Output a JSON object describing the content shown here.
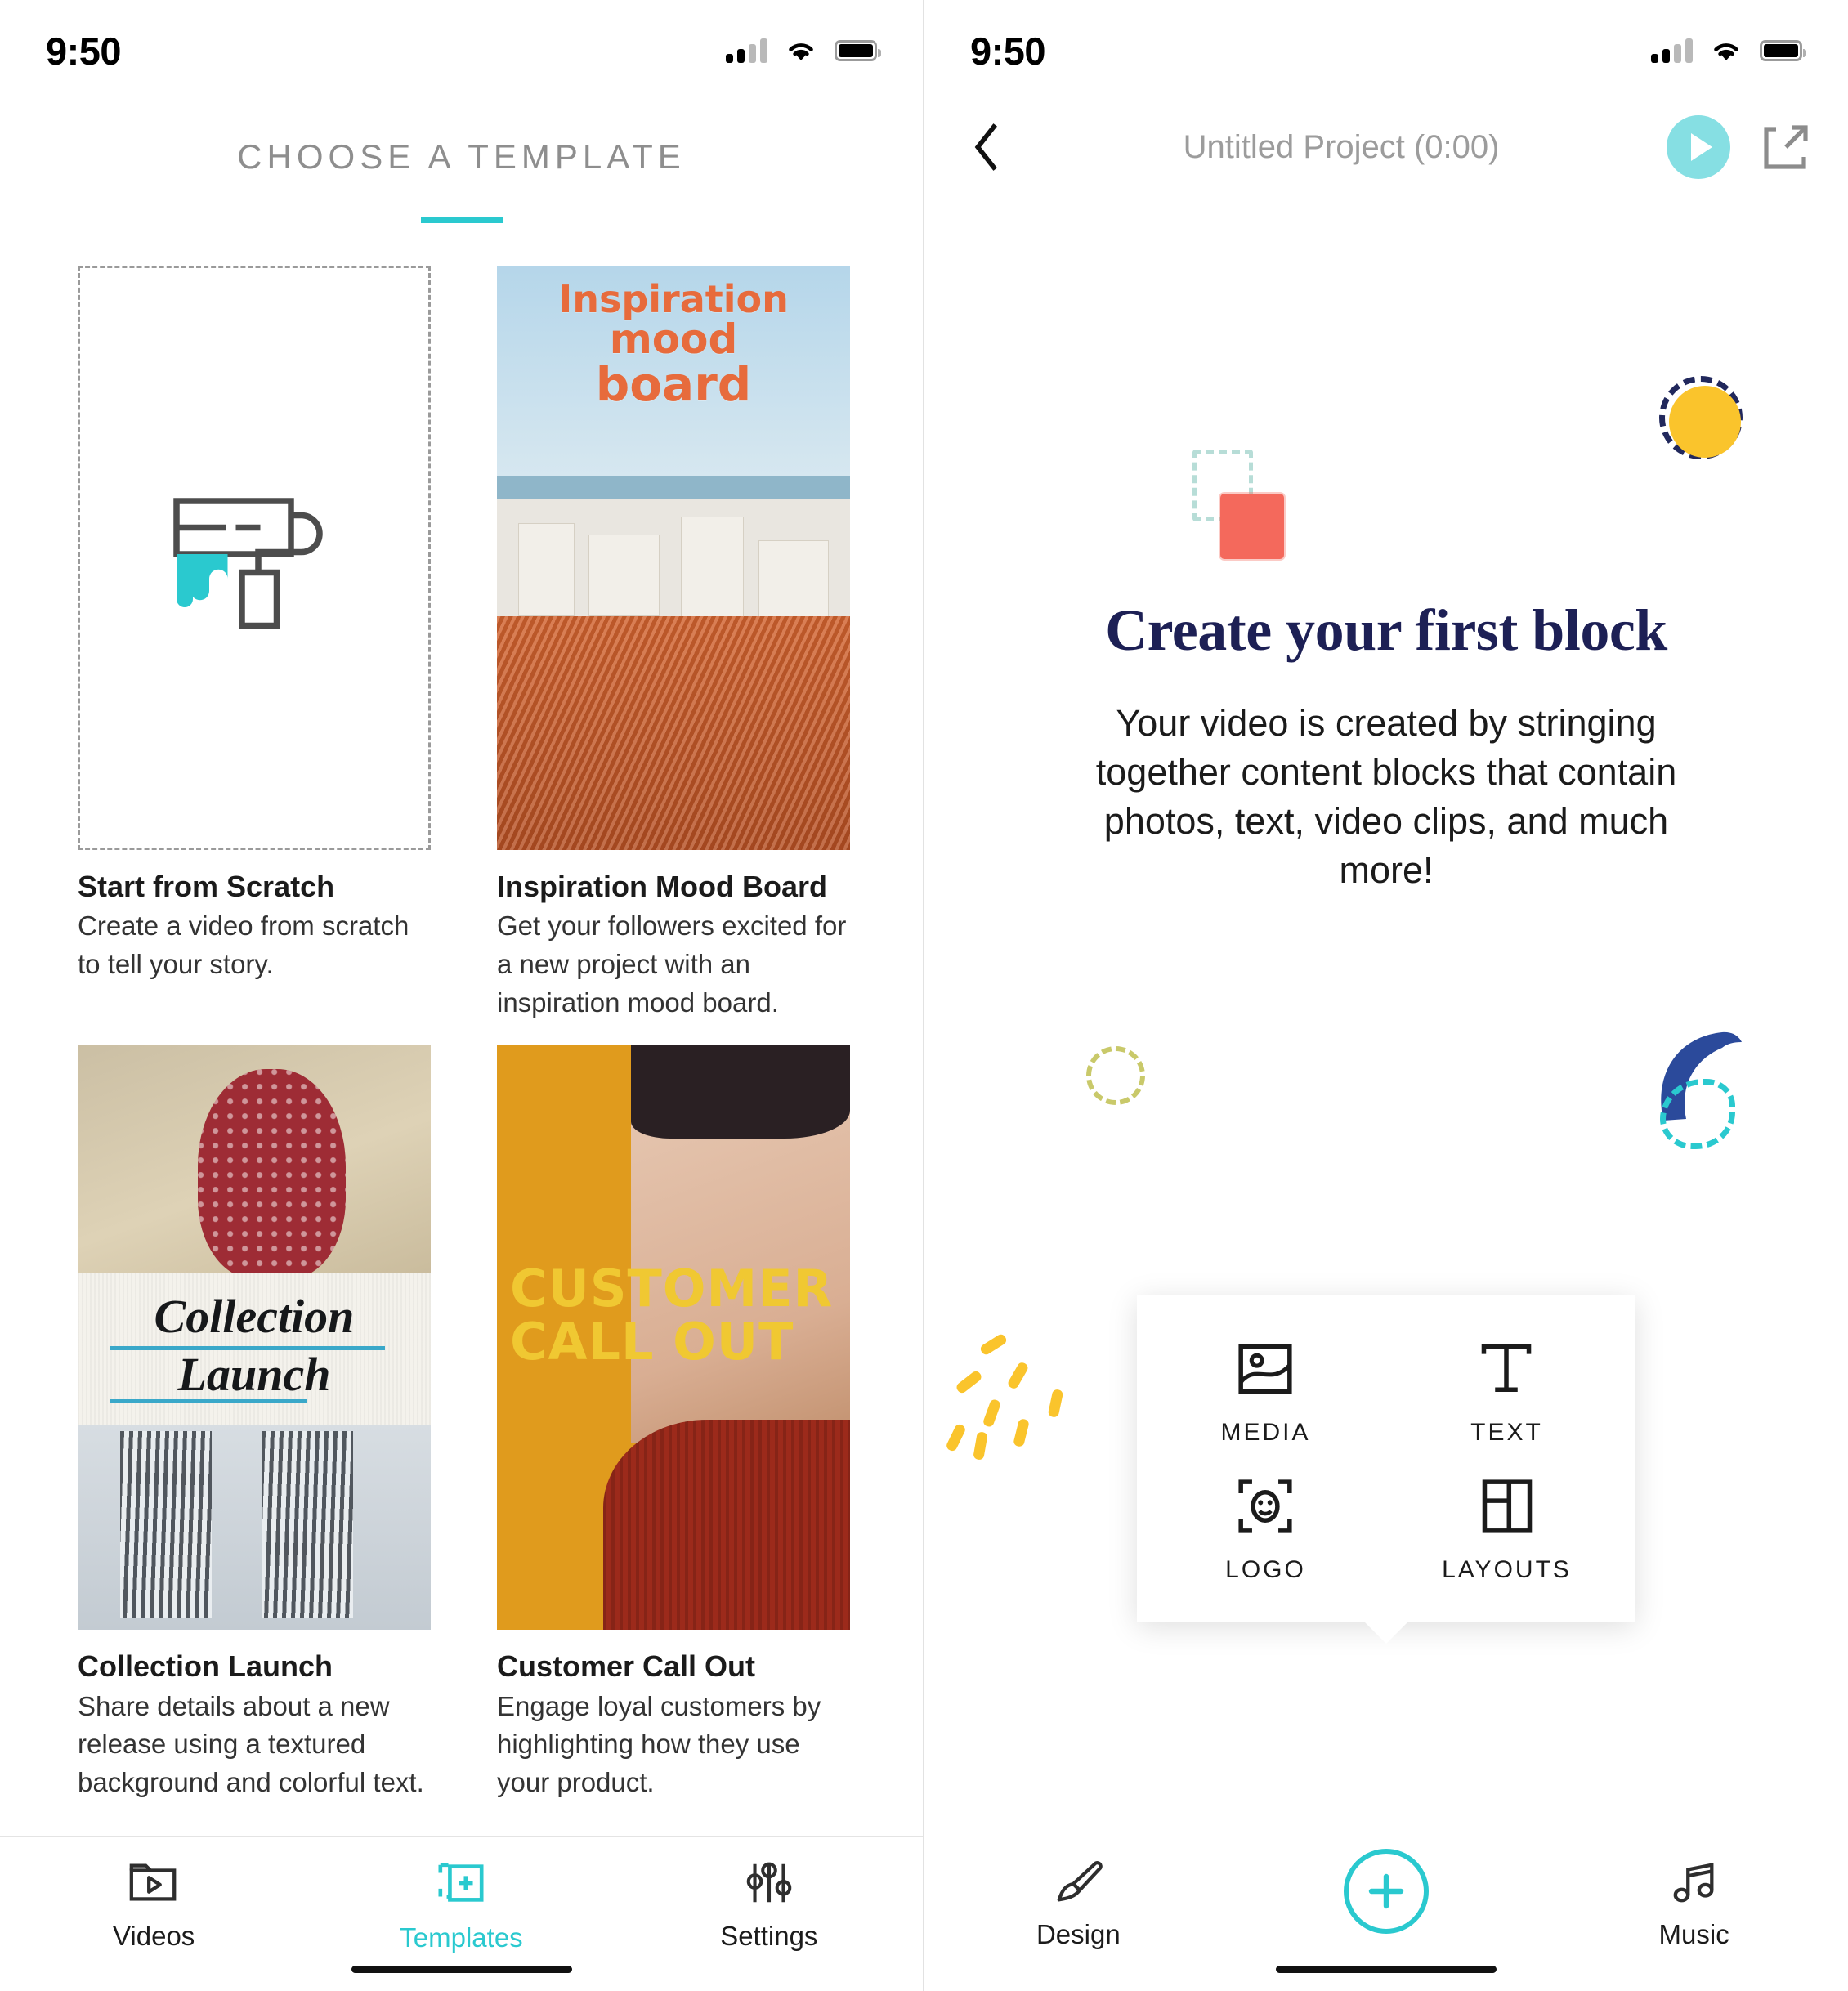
{
  "theme": {
    "accent_teal": "#2ac9cf",
    "play_teal": "#86dfe3",
    "navy": "#1d2055",
    "coral": "#f4695c",
    "yellow": "#fac42c",
    "blue_brush": "#2b4a9b"
  },
  "left_screen": {
    "status_bar": {
      "clock": "9:50",
      "signal_icon": "cellular-bars-icon",
      "wifi_icon": "wifi-icon",
      "battery_icon": "battery-icon"
    },
    "page_title": "CHOOSE A TEMPLATE",
    "templates": [
      {
        "id": "start-from-scratch",
        "title": "Start from Scratch",
        "description": "Create a video from scratch to tell your story.",
        "thumb_kind": "dashed-placeholder",
        "thumb_icon": "paint-roller-icon"
      },
      {
        "id": "inspiration-mood-board",
        "title": "Inspiration Mood Board",
        "description": "Get your followers excited for a new project with an inspiration  mood board.",
        "thumb_kind": "photo",
        "thumb_overlay": {
          "line1": "Inspiration",
          "line2": "mood",
          "line3": "board"
        }
      },
      {
        "id": "collection-launch",
        "title": "Collection Launch",
        "description": "Share details about a new release using a textured background and colorful text.",
        "thumb_kind": "photo",
        "thumb_overlay": {
          "line1": "Collection",
          "line2": "Launch"
        }
      },
      {
        "id": "customer-call-out",
        "title": "Customer Call Out",
        "description": "Engage loyal customers by highlighting how they use your product.",
        "thumb_kind": "photo",
        "thumb_overlay": {
          "line1": "CUSTOMER",
          "line2": "CALL OUT"
        }
      }
    ],
    "tabs": [
      {
        "id": "videos",
        "label": "Videos",
        "icon": "videos-folder-icon",
        "active": false
      },
      {
        "id": "templates",
        "label": "Templates",
        "icon": "template-add-icon",
        "active": true
      },
      {
        "id": "settings",
        "label": "Settings",
        "icon": "sliders-settings-icon",
        "active": false
      }
    ]
  },
  "right_screen": {
    "status_bar": {
      "clock": "9:50",
      "signal_icon": "cellular-bars-icon",
      "wifi_icon": "wifi-icon",
      "battery_icon": "battery-icon"
    },
    "nav": {
      "back_icon": "chevron-left-icon",
      "title": "Untitled Project (0:00)",
      "play_icon": "play-icon",
      "share_icon": "share-export-icon"
    },
    "hero": {
      "heading": "Create your first block",
      "body": "Your video is created by stringing together content blocks that contain photos, text, video clips, and much more!"
    },
    "popup_menu": [
      {
        "id": "media",
        "label": "MEDIA",
        "icon": "image-icon"
      },
      {
        "id": "text",
        "label": "TEXT",
        "icon": "text-t-icon"
      },
      {
        "id": "logo",
        "label": "LOGO",
        "icon": "logo-face-icon"
      },
      {
        "id": "layouts",
        "label": "LAYOUTS",
        "icon": "layout-grid-icon"
      }
    ],
    "bottom_bar": [
      {
        "id": "design",
        "label": "Design",
        "icon": "paintbrush-icon"
      },
      {
        "id": "add",
        "label": "",
        "icon": "plus-circle-icon"
      },
      {
        "id": "music",
        "label": "Music",
        "icon": "music-note-icon"
      }
    ],
    "decorations": [
      {
        "id": "dashed-square-teal",
        "icon": "dashed-square-icon"
      },
      {
        "id": "coral-square",
        "icon": "filled-square-icon"
      },
      {
        "id": "yellow-dot",
        "icon": "filled-circle-icon"
      },
      {
        "id": "navy-dashed-circle",
        "icon": "dashed-circle-icon"
      },
      {
        "id": "olive-dashed-circle",
        "icon": "dashed-circle-icon"
      },
      {
        "id": "blue-brush-arc",
        "icon": "brush-arc-icon"
      },
      {
        "id": "teal-dashed-loop",
        "icon": "dashed-loop-icon"
      },
      {
        "id": "yellow-confetti",
        "icon": "confetti-icon"
      },
      {
        "id": "pink-dashes",
        "icon": "confetti-icon"
      }
    ]
  }
}
